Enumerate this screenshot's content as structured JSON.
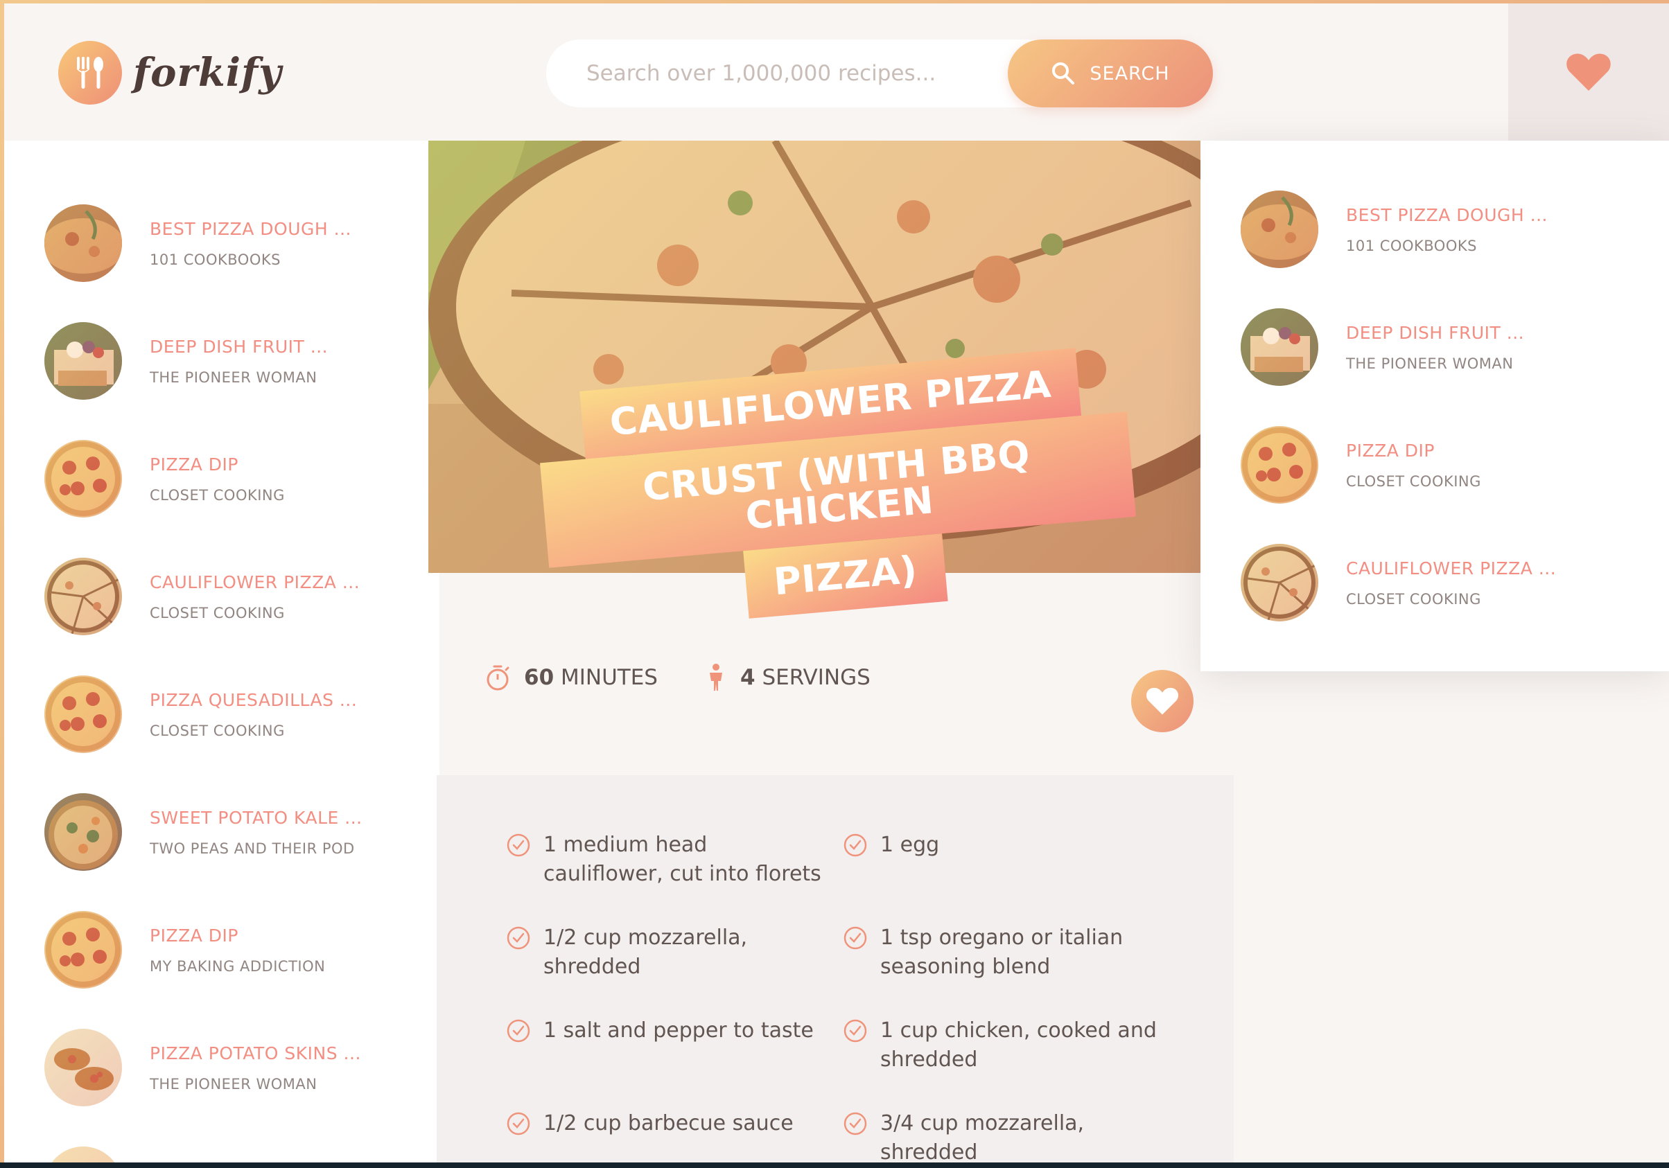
{
  "header": {
    "logo_text": "forkify",
    "search": {
      "placeholder": "Search over 1,000,000 recipes...",
      "button_label": "SEARCH"
    },
    "bookmarks_icon": "heart-icon"
  },
  "results": [
    {
      "title": "BEST PIZZA DOUGH ...",
      "publisher": "101 COOKBOOKS",
      "thumb": "pizza-dough"
    },
    {
      "title": "DEEP DISH FRUIT ...",
      "publisher": "THE PIONEER WOMAN",
      "thumb": "fruit-pizza"
    },
    {
      "title": "PIZZA DIP",
      "publisher": "CLOSET COOKING",
      "thumb": "pepperoni"
    },
    {
      "title": "CAULIFLOWER PIZZA ...",
      "publisher": "CLOSET COOKING",
      "thumb": "cauliflower"
    },
    {
      "title": "PIZZA QUESADILLAS ...",
      "publisher": "CLOSET COOKING",
      "thumb": "pepperoni"
    },
    {
      "title": "SWEET POTATO KALE ...",
      "publisher": "TWO PEAS AND THEIR POD",
      "thumb": "kale-pizza"
    },
    {
      "title": "PIZZA DIP",
      "publisher": "MY BAKING ADDICTION",
      "thumb": "pepperoni"
    },
    {
      "title": "PIZZA POTATO SKINS ...",
      "publisher": "THE PIONEER WOMAN",
      "thumb": "potato-skins"
    }
  ],
  "recipe": {
    "title_lines": [
      "CAULIFLOWER PIZZA",
      "CRUST (WITH BBQ CHICKEN",
      "PIZZA)"
    ],
    "minutes": "60",
    "minutes_label": "MINUTES",
    "servings": "4",
    "servings_label": "SERVINGS",
    "ingredients": [
      "1 medium head cauliflower, cut into florets",
      "1 egg",
      "1/2 cup mozzarella, shredded",
      "1 tsp oregano or italian seasoning blend",
      "1 salt and pepper to taste",
      "1 cup chicken, cooked and shredded",
      "1/2 cup barbecue sauce",
      "3/4 cup mozzarella, shredded"
    ]
  },
  "bookmarks": [
    {
      "title": "BEST PIZZA DOUGH ...",
      "publisher": "101 COOKBOOKS",
      "thumb": "pizza-dough"
    },
    {
      "title": "DEEP DISH FRUIT ...",
      "publisher": "THE PIONEER WOMAN",
      "thumb": "fruit-pizza"
    },
    {
      "title": "PIZZA DIP",
      "publisher": "CLOSET COOKING",
      "thumb": "pepperoni"
    },
    {
      "title": "CAULIFLOWER PIZZA ...",
      "publisher": "CLOSET COOKING",
      "thumb": "cauliflower"
    }
  ],
  "colors": {
    "accent_start": "#fbdb89",
    "accent_end": "#f48982",
    "title_text": "#f38e82",
    "body_text": "#615551",
    "muted_text": "#918581"
  }
}
